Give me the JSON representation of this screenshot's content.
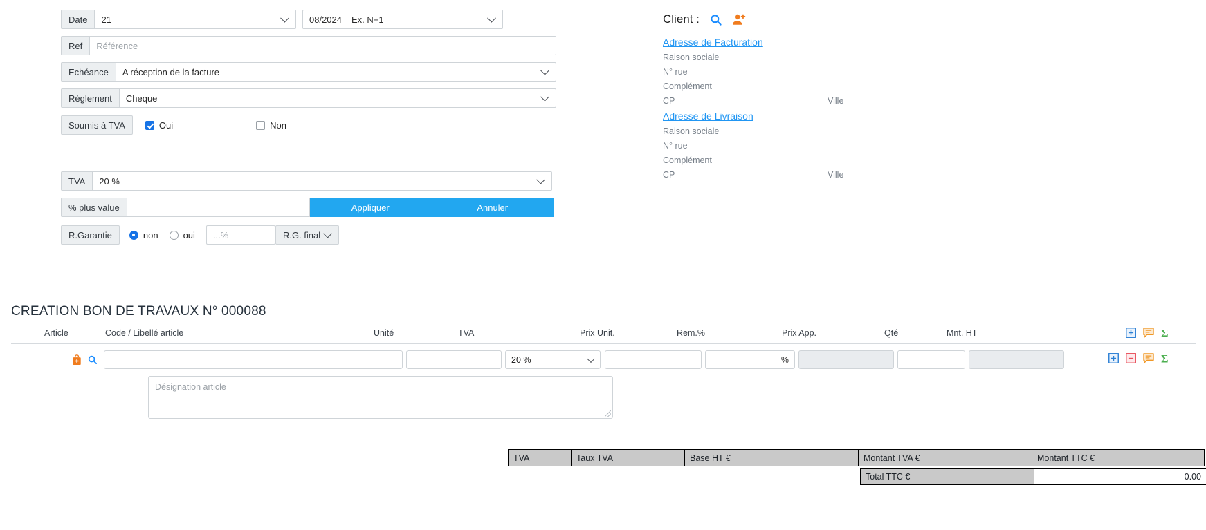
{
  "form": {
    "date": {
      "label": "Date",
      "value": "21",
      "period": "08/2024",
      "exercise": "Ex. N+1"
    },
    "ref": {
      "label": "Ref",
      "placeholder": "Référence",
      "value": ""
    },
    "echeance": {
      "label": "Echéance",
      "value": "A réception de la facture"
    },
    "reglement": {
      "label": "Règlement",
      "value": "Cheque"
    },
    "soumis_tva": {
      "label": "Soumis à TVA",
      "option_yes": "Oui",
      "option_no": "Non",
      "selected": "Oui"
    },
    "tva": {
      "label": "TVA",
      "value": "20 %"
    },
    "plus_value": {
      "label": "% plus value",
      "value": "",
      "apply_label": "Appliquer",
      "cancel_label": "Annuler"
    },
    "garantie": {
      "label": "R.Garantie",
      "option_no": "non",
      "option_yes": "oui",
      "selected": "non",
      "pct_placeholder": "...%",
      "pct_value": "",
      "type_value": "R.G. final"
    }
  },
  "client": {
    "title": "Client :",
    "billing": {
      "link": "Adresse de Facturation",
      "lines": [
        "Raison sociale",
        "N° rue",
        "Complément"
      ],
      "cp": "CP",
      "ville": "Ville"
    },
    "delivery": {
      "link": "Adresse de Livraison",
      "lines": [
        "Raison sociale",
        "N° rue",
        "Complément"
      ],
      "cp": "CP",
      "ville": "Ville"
    }
  },
  "document": {
    "title": "CREATION BON DE TRAVAUX N° 000088",
    "columns": [
      "Article",
      "Code / Libellé article",
      "Unité",
      "TVA",
      "Prix Unit.",
      "Rem.%",
      "Prix App.",
      "Qté",
      "Mnt. HT"
    ],
    "item": {
      "code": "",
      "unite": "",
      "tva": "20 %",
      "prix_unit": "",
      "remise": "",
      "remise_suffix": "%",
      "prix_app": "",
      "qte": "",
      "mnt_ht": "",
      "designation_placeholder": "Désignation article"
    }
  },
  "totals": {
    "headers": [
      "TVA",
      "Taux TVA",
      "Base HT €",
      "Montant TVA €",
      "Montant TTC €"
    ],
    "total_label": "Total TTC €",
    "total_value": "0.00"
  },
  "colors": {
    "accent_blue": "#22a7f0",
    "link_blue": "#2196f3",
    "icon_orange": "#f07c1e",
    "icon_green": "#4caf50",
    "icon_red": "#e8505b",
    "checkbox_blue": "#1673e6"
  }
}
